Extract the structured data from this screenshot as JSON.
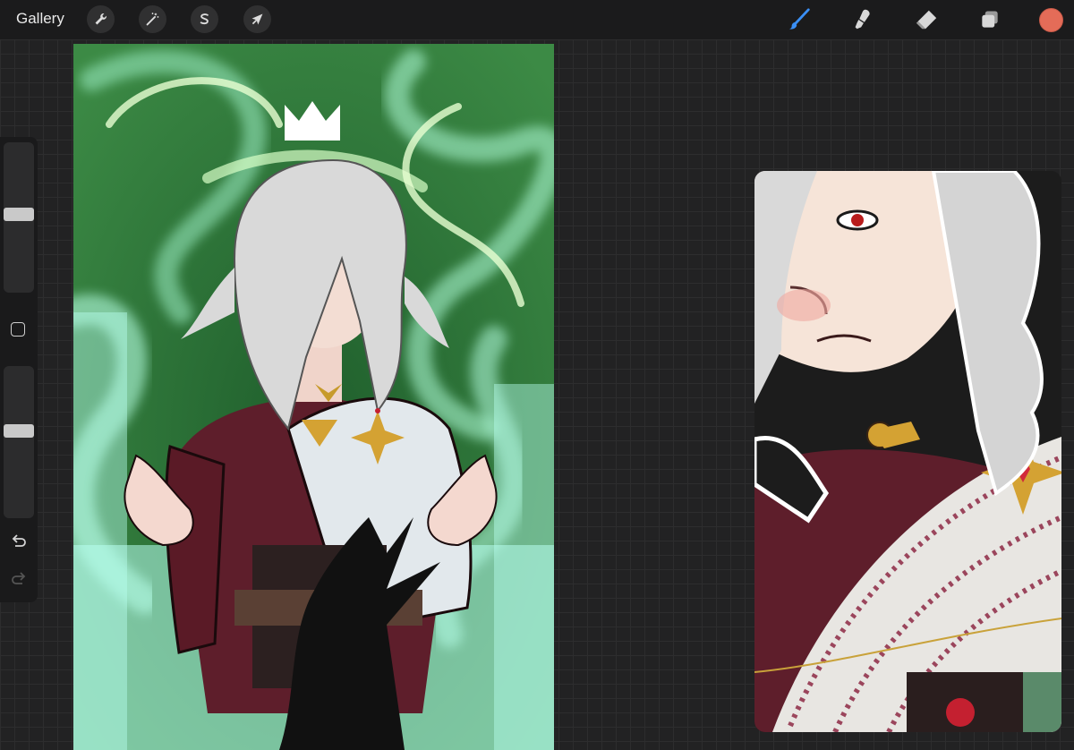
{
  "topbar": {
    "gallery_label": "Gallery",
    "left_tools": [
      {
        "name": "actions",
        "icon": "wrench-icon"
      },
      {
        "name": "adjustments",
        "icon": "magic-wand-icon"
      },
      {
        "name": "selection",
        "icon": "selection-s-icon"
      },
      {
        "name": "transform",
        "icon": "arrow-cursor-icon"
      }
    ],
    "right_tools": [
      {
        "name": "brush",
        "icon": "brush-icon",
        "active": true
      },
      {
        "name": "smudge",
        "icon": "smudge-icon"
      },
      {
        "name": "eraser",
        "icon": "eraser-icon"
      },
      {
        "name": "layers",
        "icon": "layers-icon"
      }
    ],
    "current_color": "#e46c58",
    "active_tool_color": "#3a8ff5"
  },
  "sidebar": {
    "brush_size_level": 0.52,
    "opacity_level": 0.58
  },
  "colors": {
    "canvas_green": "#2f7a3a",
    "glow": "#b9ffe9",
    "robe": "#5e1e2b",
    "hair": "#d9d9d9"
  }
}
